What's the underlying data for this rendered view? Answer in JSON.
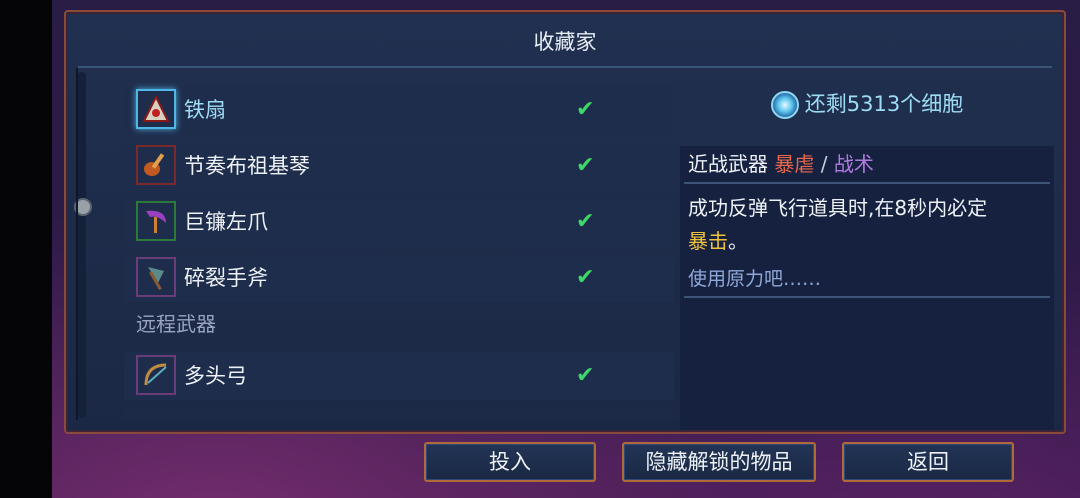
{
  "title": "收藏家",
  "list": {
    "items": [
      {
        "label": "铁扇",
        "checked": "✔",
        "icon": "iron-fan-icon",
        "selected": true
      },
      {
        "label": "节奏布祖基琴",
        "checked": "✔",
        "icon": "bouzouki-icon"
      },
      {
        "label": "巨镰左爪",
        "checked": "✔",
        "icon": "scythe-claw-icon"
      },
      {
        "label": "碎裂手斧",
        "checked": "✔",
        "icon": "hatchet-icon"
      }
    ],
    "section_ranged": "远程武器",
    "ranged_items": [
      {
        "label": "多头弓",
        "checked": "✔",
        "icon": "multi-bow-icon"
      }
    ]
  },
  "detail": {
    "cells_text": "还剩5313个细胞",
    "category": "近战武器",
    "tag1": "暴虐",
    "separator": "/",
    "tag2": "战术",
    "desc_main": "成功反弹飞行道具时,在8秒内必定",
    "desc_highlight": "暴击",
    "desc_end": "。",
    "flavor": "使用原力吧……"
  },
  "buttons": {
    "invest": "投入",
    "hide_unlocked": "隐藏解锁的物品",
    "back": "返回"
  },
  "colors": {
    "accent_cyan": "#9edcf5",
    "check_green": "#3dd86a",
    "tag_red": "#e8674a",
    "tag_purple": "#b07be0",
    "highlight_yellow": "#f0c33a",
    "button_border": "#b06a3a"
  }
}
